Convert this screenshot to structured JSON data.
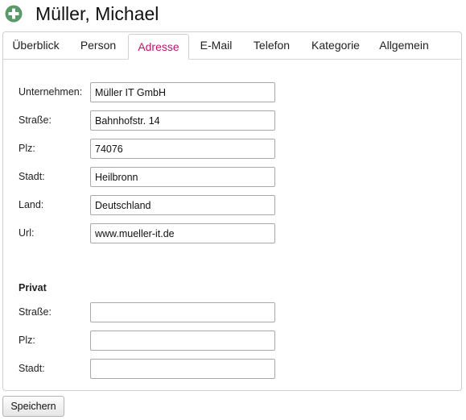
{
  "header": {
    "title": "Müller, Michael",
    "icon": "add-circle-icon"
  },
  "colors": {
    "icon_green": "#5b9a68",
    "active_tab": "#b5176e",
    "panel_border": "#cfcfcf"
  },
  "tabs": [
    {
      "label": "Überblick",
      "active": false
    },
    {
      "label": "Person",
      "active": false
    },
    {
      "label": "Adresse",
      "active": true
    },
    {
      "label": "E-Mail",
      "active": false
    },
    {
      "label": "Telefon",
      "active": false
    },
    {
      "label": "Kategorie",
      "active": false
    },
    {
      "label": "Allgemein",
      "active": false
    }
  ],
  "business": {
    "fields": [
      {
        "label": "Unternehmen:",
        "value": "Müller IT GmbH"
      },
      {
        "label": "Straße:",
        "value": "Bahnhofstr. 14"
      },
      {
        "label": "Plz:",
        "value": "74076"
      },
      {
        "label": "Stadt:",
        "value": "Heilbronn"
      },
      {
        "label": "Land:",
        "value": "Deutschland"
      },
      {
        "label": "Url:",
        "value": "www.mueller-it.de"
      }
    ]
  },
  "private": {
    "title": "Privat",
    "fields": [
      {
        "label": "Straße:",
        "value": ""
      },
      {
        "label": "Plz:",
        "value": ""
      },
      {
        "label": "Stadt:",
        "value": ""
      }
    ]
  },
  "actions": {
    "save_label": "Speichern"
  }
}
